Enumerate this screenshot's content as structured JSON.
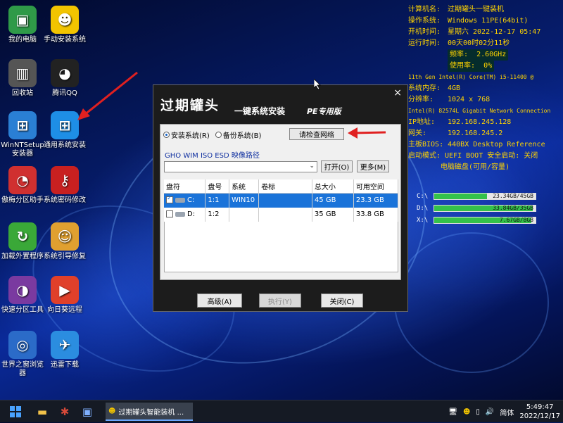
{
  "desktop_icons": [
    {
      "label": "我的电脑",
      "icon": "computer-icon",
      "color": "#2f9a48",
      "glyph": "▣"
    },
    {
      "label": "手动安装系统",
      "icon": "android-icon",
      "color": "#f2c400",
      "glyph": "☻"
    },
    {
      "label": "回收站",
      "icon": "recycle-bin-icon",
      "color": "#555555",
      "glyph": "▥"
    },
    {
      "label": "腾讯QQ",
      "icon": "qq-icon",
      "color": "#222222",
      "glyph": "◕"
    },
    {
      "label": "WinNTSetup安装器",
      "icon": "winntsetup-icon",
      "color": "#2a7fd4",
      "glyph": "⊞"
    },
    {
      "label": "通用系统安装",
      "icon": "windows-icon",
      "color": "#1e8ee6",
      "glyph": "⊞"
    },
    {
      "label": "傲梅分区助手",
      "icon": "partition-icon",
      "color": "#d03030",
      "glyph": "◔"
    },
    {
      "label": "系统密码修改",
      "icon": "key-icon",
      "color": "#c82020",
      "glyph": "⚷"
    },
    {
      "label": "加载外置程序",
      "icon": "refresh-icon",
      "color": "#3aa838",
      "glyph": "↻"
    },
    {
      "label": "系统引导修复",
      "icon": "repair-icon",
      "color": "#e0a030",
      "glyph": "☺"
    },
    {
      "label": "快速分区工具",
      "icon": "pie-icon",
      "color": "#7a3aa0",
      "glyph": "◑"
    },
    {
      "label": "向日葵远程",
      "icon": "sunflower-icon",
      "color": "#e0402a",
      "glyph": "▶"
    },
    {
      "label": "世界之窗浏览器",
      "icon": "globe-icon",
      "color": "#2b6bc8",
      "glyph": "◎"
    },
    {
      "label": "迅雷下载",
      "icon": "thunder-icon",
      "color": "#2b8de0",
      "glyph": "✈"
    }
  ],
  "sysinfo": {
    "rows": [
      {
        "k": "计算机名:",
        "v": "过期罐头一键装机"
      },
      {
        "k": "操作系统:",
        "v": "Windows 11PE(64bit)"
      },
      {
        "k": "开机时间:",
        "v": "星期六 2022-12-17 05:47"
      },
      {
        "k": "运行时间:",
        "v": "00天00时02分11秒"
      }
    ],
    "freq_label": "频率:",
    "freq_value": "2.60GHz",
    "usage_label": "使用率:",
    "usage_value": "0%",
    "cpu_name": "11th Gen Intel(R) Core(TM) i5-11400 @",
    "rows2": [
      {
        "k": "系统内存:",
        "v": "4GB"
      },
      {
        "k": "分辨率:",
        "v": "1024 x 768"
      }
    ],
    "nic": "Intel(R) 82574L Gigabit Network Connection",
    "rows3": [
      {
        "k": "IP地址:",
        "v": "192.168.245.128"
      },
      {
        "k": "网关:",
        "v": "192.168.245.2"
      }
    ],
    "bios": "主板BIOS: 440BX Desktop Reference",
    "boot": "启动模式: UEFI BOOT 安全启动: 关闭",
    "disk_header": "电脑磁盘(可用/容量)"
  },
  "drives": [
    {
      "label": "C:\\",
      "text": "23.34GB/45GB",
      "used": 0.48
    },
    {
      "label": "D:\\",
      "text": "33.84GB/35GB",
      "used": 0.03
    },
    {
      "label": "X:\\",
      "text": "7.67GB/8GB",
      "used": 0.04
    }
  ],
  "dialog": {
    "title_big": "过期罐头",
    "title_mid": "一键系统安装",
    "title_pe": "PE专用版",
    "close": "×",
    "radio_install": "安装系统(R)",
    "radio_backup": "备份系统(B)",
    "check_network": "请检查网络",
    "image_label": "GHO WIM ISO ESD 映像路径",
    "image_path": "",
    "open_btn": "打开(O)",
    "more_btn": "更多(M)",
    "columns": [
      "盘符",
      "盘号",
      "系统",
      "卷标",
      "总大小",
      "可用空间"
    ],
    "rows": [
      {
        "drive": "C:",
        "num": "1:1",
        "sys": "WIN10",
        "vol": "",
        "total": "45 GB",
        "free": "23.3 GB",
        "selected": true
      },
      {
        "drive": "D:",
        "num": "1:2",
        "sys": "",
        "vol": "",
        "total": "35 GB",
        "free": "33.8 GB",
        "selected": false
      }
    ],
    "advanced_btn": "高级(A)",
    "execute_btn": "执行(Y)",
    "close_btn": "关闭(C)"
  },
  "taskbar": {
    "app_title": "过期罐头智能装机 ...",
    "ime": "简体",
    "time": "5:49:47",
    "date": "2022/12/17"
  }
}
